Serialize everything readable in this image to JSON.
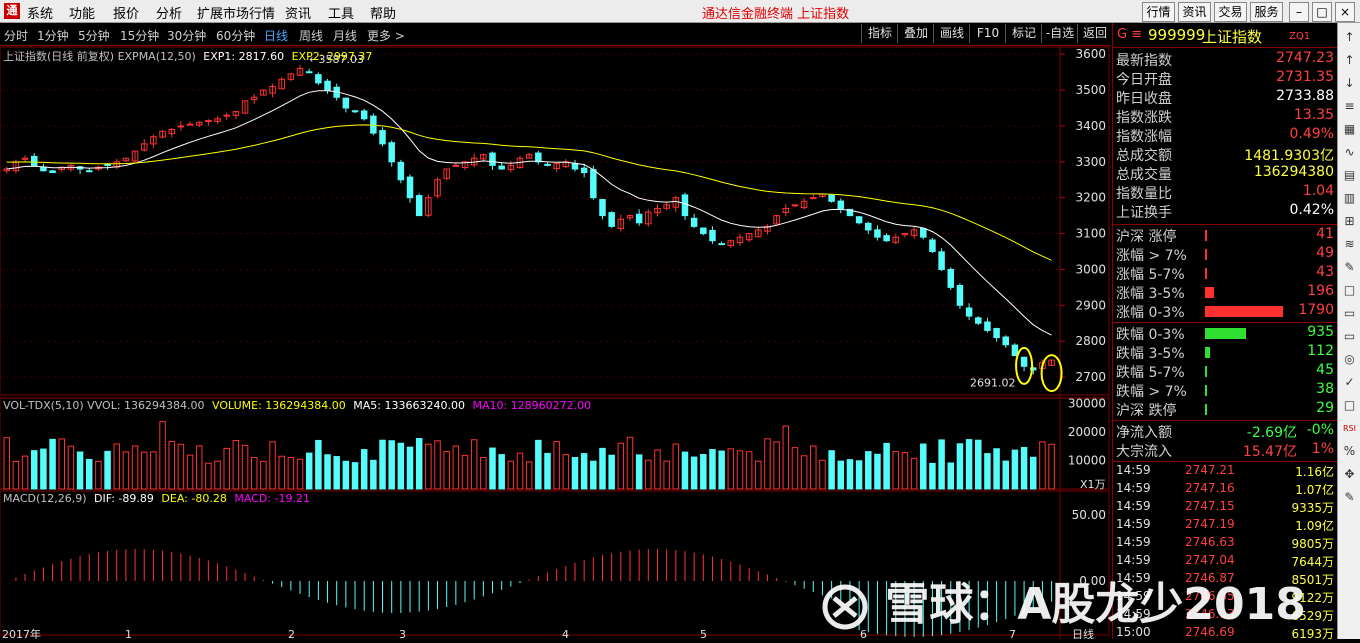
{
  "menubar": {
    "logo": "通",
    "items": [
      "系统",
      "功能",
      "报价",
      "分析",
      "扩展市场行情",
      "资讯",
      "工具",
      "帮助"
    ],
    "app_title": "通达信金融终端  上证指数",
    "right_buttons": [
      "行情",
      "资讯",
      "交易",
      "服务"
    ]
  },
  "periods": [
    "分时",
    "1分钟",
    "5分钟",
    "15分钟",
    "30分钟",
    "60分钟",
    "日线",
    "周线",
    "月线",
    "更多 >"
  ],
  "active_period": "日线",
  "tools": [
    "指标",
    "叠加",
    "画线",
    "F10",
    "标记",
    "-自选",
    "返回"
  ],
  "price_panel": {
    "info": "上证指数(日线 前复权) EXPMA(12,50)",
    "exp1": "EXP1: 2817.60",
    "exp2": "EXP2: 2997.37",
    "high_label": "3587.03",
    "low_label": "2691.02",
    "y_ticks": [
      "3600",
      "3500",
      "3400",
      "3300",
      "3200",
      "3100",
      "3000",
      "2900",
      "2800",
      "2700"
    ]
  },
  "vol_panel": {
    "info": "VOL-TDX(5,10) VVOL: 136294384.00",
    "volume": "VOLUME: 136294384.00",
    "ma5": "MA5: 133663240.00",
    "ma10": "MA10: 128960272.00",
    "y_ticks": [
      "30000",
      "20000",
      "10000"
    ],
    "unit": "X1万"
  },
  "macd_panel": {
    "info": "MACD(12,26,9)",
    "dif": "DIF: -89.89",
    "dea": "DEA: -80.28",
    "macd": "MACD: -19.21",
    "y_ticks": [
      "50.00",
      "0.00"
    ]
  },
  "x_axis": {
    "start": "2017年",
    "marks": [
      "1",
      "2",
      "3",
      "4",
      "5",
      "6",
      "7"
    ],
    "end": "日线"
  },
  "right_panel": {
    "code": "999999",
    "name": "上证指数",
    "tag": "ZQ1",
    "quote_rows": [
      {
        "label": "最新指数",
        "value": "2747.23",
        "color": "red"
      },
      {
        "label": "今日开盘",
        "value": "2731.35",
        "color": "red"
      },
      {
        "label": "昨日收盘",
        "value": "2733.88",
        "color": "white"
      },
      {
        "label": "指数涨跌",
        "value": "13.35",
        "color": "red"
      },
      {
        "label": "指数涨幅",
        "value": "0.49%",
        "color": "red"
      },
      {
        "label": "总成交额",
        "value": "1481.9303亿",
        "color": "yellow"
      },
      {
        "label": "总成交量",
        "value": "136294380",
        "color": "yellow"
      },
      {
        "label": "指数量比",
        "value": "1.04",
        "color": "red"
      },
      {
        "label": "上证换手",
        "value": "0.42%",
        "color": "white"
      }
    ],
    "up_rows": [
      {
        "label": "沪深 涨停",
        "value": "41",
        "bar": 0.01
      },
      {
        "label": "涨幅 > 7%",
        "value": "49",
        "bar": 0.03
      },
      {
        "label": "涨幅 5-7%",
        "value": "43",
        "bar": 0.02
      },
      {
        "label": "涨幅 3-5%",
        "value": "196",
        "bar": 0.11
      },
      {
        "label": "涨幅 0-3%",
        "value": "1790",
        "bar": 1.0
      }
    ],
    "down_rows": [
      {
        "label": "跌幅 0-3%",
        "value": "935",
        "bar": 0.52
      },
      {
        "label": "跌幅 3-5%",
        "value": "112",
        "bar": 0.06
      },
      {
        "label": "跌幅 5-7%",
        "value": "45",
        "bar": 0.02
      },
      {
        "label": "跌幅 > 7%",
        "value": "38",
        "bar": 0.02
      },
      {
        "label": "沪深 跌停",
        "value": "29",
        "bar": 0.01
      }
    ],
    "flow_rows": [
      {
        "label": "净流入额",
        "value": "-2.69亿",
        "pct": "-0%",
        "color": "green"
      },
      {
        "label": "大宗流入",
        "value": "15.47亿",
        "pct": "1%",
        "color": "red"
      }
    ],
    "ticks": [
      {
        "time": "14:59",
        "price": "2747.21",
        "vol": "1.16亿"
      },
      {
        "time": "14:59",
        "price": "2747.16",
        "vol": "1.07亿"
      },
      {
        "time": "14:59",
        "price": "2747.15",
        "vol": "9335万"
      },
      {
        "time": "14:59",
        "price": "2747.19",
        "vol": "1.09亿"
      },
      {
        "time": "14:59",
        "price": "2746.63",
        "vol": "9805万"
      },
      {
        "time": "14:59",
        "price": "2747.04",
        "vol": "7644万"
      },
      {
        "time": "14:59",
        "price": "2746.87",
        "vol": "8501万"
      },
      {
        "time": "14:59",
        "price": "2746.85",
        "vol": "9122万"
      },
      {
        "time": "14:59",
        "price": "2746.93",
        "vol": "6529万"
      },
      {
        "time": "15:00",
        "price": "2746.69",
        "vol": "6193万"
      }
    ]
  },
  "watermark": "雪球：A股龙少2018",
  "chart_data": {
    "type": "candlestick",
    "title": "上证指数(日线 前复权)",
    "ylim": [
      2650,
      3620
    ],
    "high": 3587.03,
    "low": 2691.02,
    "closes": [
      3280,
      3300,
      3310,
      3290,
      3275,
      3270,
      3285,
      3290,
      3280,
      3275,
      3285,
      3290,
      3300,
      3310,
      3330,
      3350,
      3370,
      3385,
      3390,
      3400,
      3405,
      3410,
      3415,
      3420,
      3430,
      3440,
      3470,
      3480,
      3500,
      3510,
      3530,
      3545,
      3560,
      3550,
      3520,
      3500,
      3480,
      3450,
      3440,
      3420,
      3380,
      3350,
      3300,
      3250,
      3200,
      3150,
      3200,
      3250,
      3280,
      3290,
      3300,
      3310,
      3320,
      3290,
      3280,
      3290,
      3310,
      3320,
      3300,
      3290,
      3295,
      3300,
      3280,
      3270,
      3200,
      3150,
      3120,
      3140,
      3150,
      3130,
      3160,
      3170,
      3180,
      3200,
      3150,
      3120,
      3100,
      3080,
      3070,
      3080,
      3090,
      3100,
      3110,
      3120,
      3150,
      3170,
      3180,
      3190,
      3200,
      3210,
      3190,
      3170,
      3150,
      3130,
      3110,
      3090,
      3080,
      3090,
      3100,
      3110,
      3090,
      3050,
      3000,
      2950,
      2900,
      2870,
      2850,
      2830,
      2810,
      2790,
      2760,
      2730,
      2720,
      2740,
      2747.23
    ],
    "exp1_end": 2817.6,
    "exp2_end": 2997.37,
    "volume_ylim": [
      0,
      32000
    ],
    "macd": {
      "dif": -89.89,
      "dea": -80.28,
      "macd": -19.21
    }
  },
  "colors": {
    "up": "#ff3232",
    "down": "#54fcfc",
    "exp1": "#ffffff",
    "exp2": "#ffff00",
    "ma10": "#ff00ff"
  }
}
